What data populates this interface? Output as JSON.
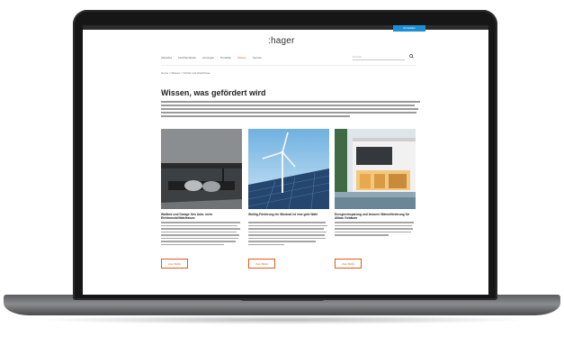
{
  "site": {
    "logo": ":hager",
    "login_label": "Anmelden",
    "nav": [
      "Aktuelles",
      "Fachhandwerk",
      "Lösungen",
      "Produkte",
      "Wissen",
      "Service"
    ],
    "nav_active_index": 4,
    "search_placeholder": "Suchen",
    "breadcrumb": "Home > Wissen > Förder und Zuschüsse",
    "title": "Wissen, was gefördert wird",
    "cards": [
      {
        "title": "Wallbox und Garage fürs Auto: mehr Elektromobilitätsfeature",
        "button": "Zum BAfA"
      },
      {
        "title": "Wohlig-Förderung ein Windrad ist eine gute Wahl",
        "button": "Zum BAfA"
      },
      {
        "title": "Energieeinsparung und bessere Wärmeförderung für Altbau Gebäude",
        "button": "Zum BAfA"
      }
    ]
  },
  "colors": {
    "accent": "#e05a1c",
    "login_blue": "#1e8fd4",
    "topbar": "#2c2c2c"
  }
}
